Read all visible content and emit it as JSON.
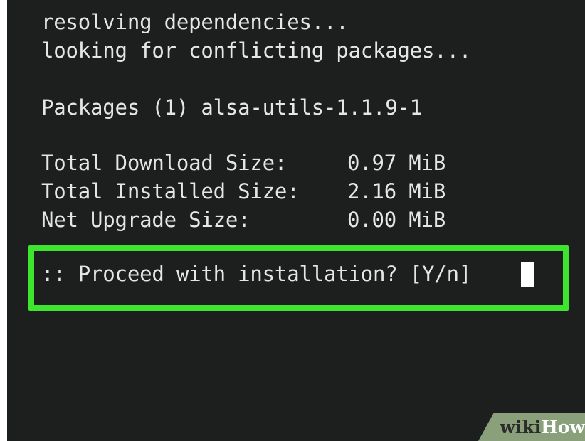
{
  "terminal": {
    "lines": [
      "resolving dependencies...",
      "looking for conflicting packages...",
      "Packages (1) alsa-utils-1.1.9-1"
    ],
    "sizes": [
      {
        "label": "Total Download Size:",
        "value": "0.97 MiB"
      },
      {
        "label": "Total Installed Size:",
        "value": "2.16 MiB"
      },
      {
        "label": "Net Upgrade Size:",
        "value": "0.00 MiB"
      }
    ],
    "prompt": ":: Proceed with installation? [Y/n]"
  },
  "watermark": {
    "part_a": "wiki",
    "part_b": "How"
  },
  "colors": {
    "terminal_bg": "#1d1f1f",
    "text": "#e6e6e6",
    "highlight": "#3ee52f",
    "watermark_tab": "#8aa07a"
  }
}
